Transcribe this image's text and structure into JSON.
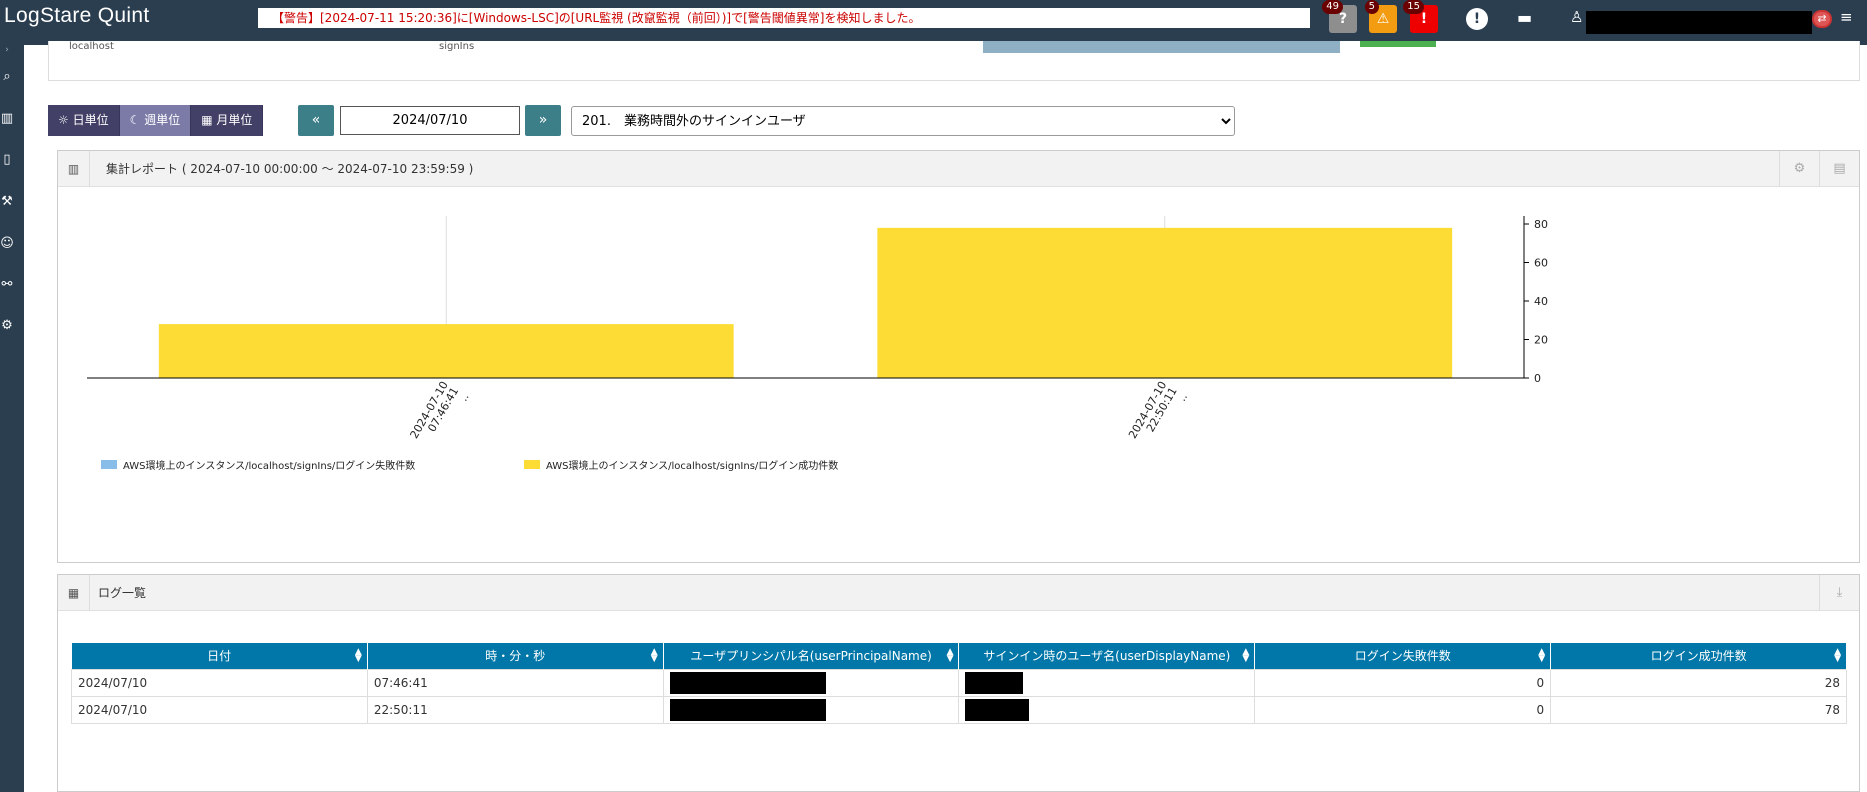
{
  "header": {
    "app_title": "LogStare Quint",
    "alert_message": "【警告】[2024-07-11 15:20:36]に[Windows-LSC]の[URL監視 (改竄監視（前回）)]で[警告閾値異常]を検知しました。",
    "badges": {
      "info": "49",
      "warning": "5",
      "error": "15"
    },
    "icons": [
      "question-icon",
      "warning-icon",
      "error-icon",
      "exclamation-icon",
      "chat-icon",
      "user-icon",
      "logout-icon",
      "menu-icon"
    ]
  },
  "sidebar": {
    "icons": [
      "search-icon",
      "chart-icon",
      "book-icon",
      "wrench-icon",
      "users-icon",
      "network-icon",
      "gear-icon"
    ]
  },
  "top_panel": {
    "col1": "localhost",
    "col2": "signIns"
  },
  "controls": {
    "day": "日単位",
    "week": "週単位",
    "month": "月単位",
    "date": "2024/07/10",
    "report": "201.　業務時間外のサインインユーザ"
  },
  "chart_panel": {
    "title": "集計レポート ( 2024-07-10 00:00:00 ～ 2024-07-10 23:59:59 )"
  },
  "chart_data": {
    "type": "bar",
    "categories": [
      "2024-07-10 07:46:41 ..",
      "2024-07-10 22:50:11 .."
    ],
    "series": [
      {
        "name": "AWS環境上のインスタンス/localhost/signIns/ログイン失敗件数",
        "values": [
          0,
          0
        ],
        "color": "#87bde8"
      },
      {
        "name": "AWS環境上のインスタンス/localhost/signIns/ログイン成功件数",
        "values": [
          28,
          78
        ],
        "color": "#fcdc35"
      }
    ],
    "yticks": [
      0,
      20,
      40,
      60,
      80
    ],
    "ylim": [
      0,
      80
    ],
    "y_axis_side": "right",
    "legend_position": "bottom-left"
  },
  "log_panel": {
    "title": "ログ一覧"
  },
  "table": {
    "headers": [
      "日付",
      "時・分・秒",
      "ユーザプリンシパル名(userPrincipalName)",
      "サインイン時のユーザ名(userDisplayName)",
      "ログイン失敗件数",
      "ログイン成功件数"
    ],
    "rows": [
      {
        "date": "2024/07/10",
        "time": "07:46:41",
        "failed": "0",
        "success": "28"
      },
      {
        "date": "2024/07/10",
        "time": "22:50:11",
        "failed": "0",
        "success": "78"
      }
    ]
  }
}
